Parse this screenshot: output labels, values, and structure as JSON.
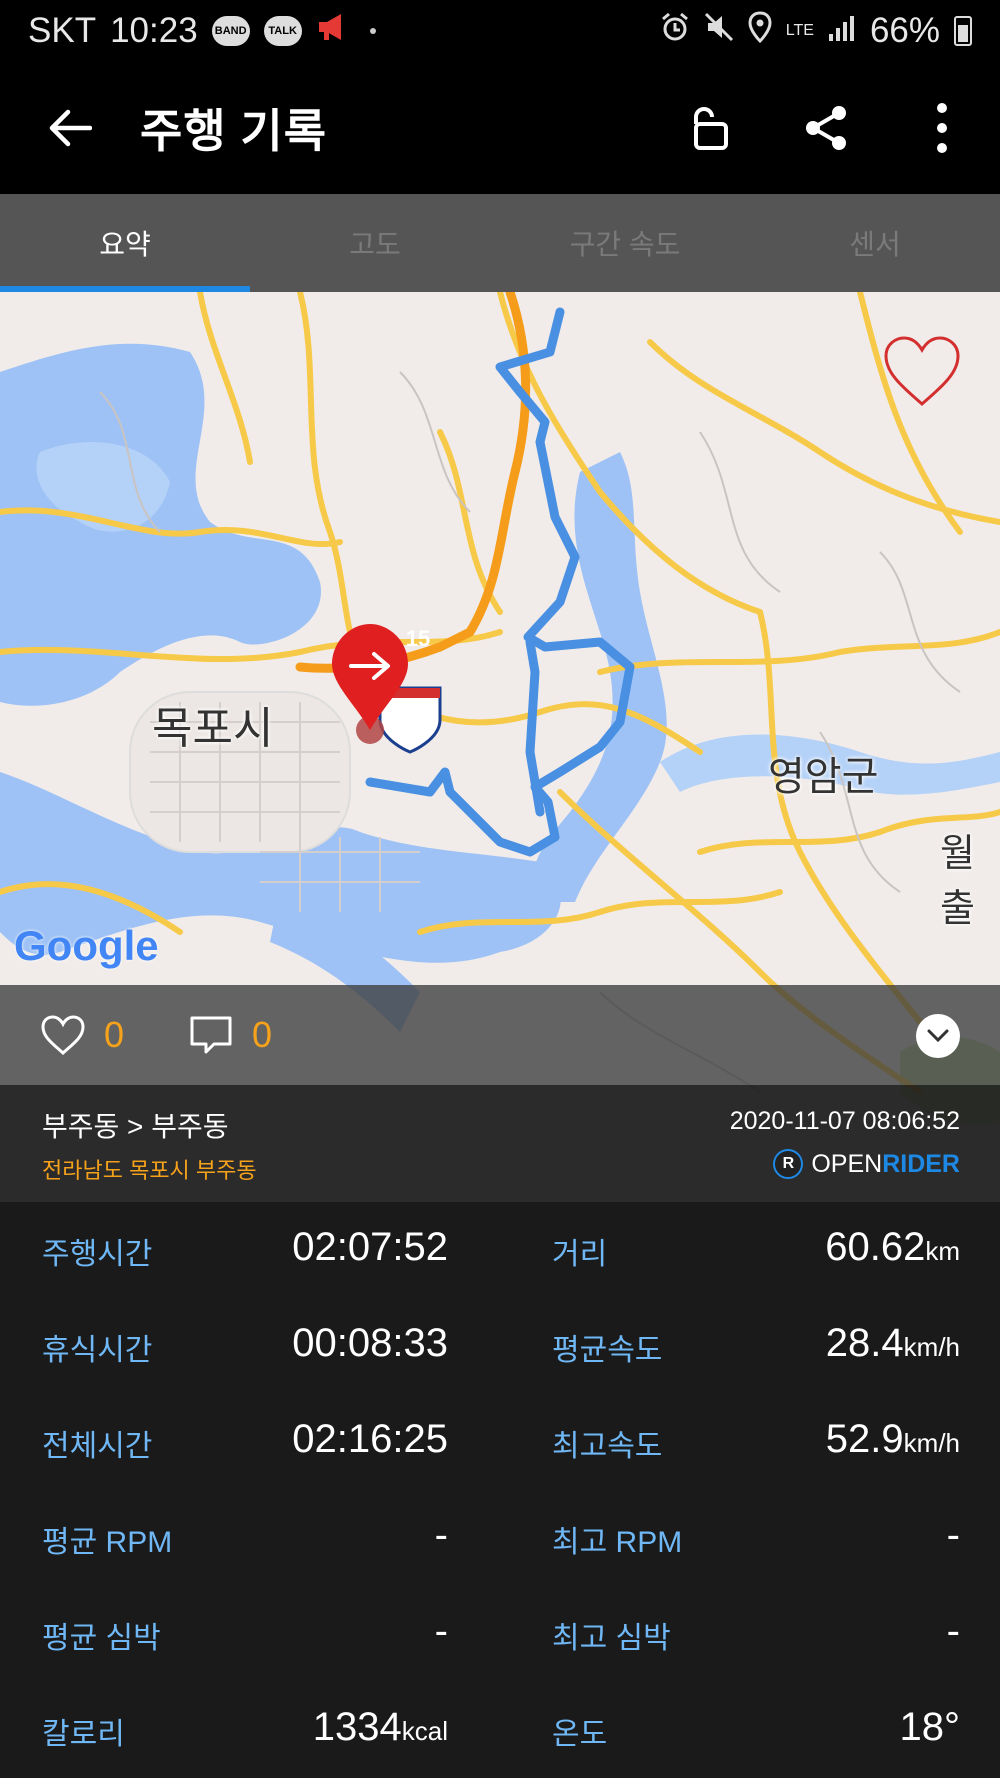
{
  "status_bar": {
    "carrier": "SKT",
    "time": "10:23",
    "badges": [
      "BAND",
      "TALK"
    ],
    "network": "LTE",
    "battery": "66%"
  },
  "app_bar": {
    "title": "주행 기록",
    "icons": [
      "back-arrow-icon",
      "unlock-icon",
      "share-icon",
      "more-vert-icon"
    ]
  },
  "tabs": [
    {
      "label": "요약",
      "active": true
    },
    {
      "label": "고도",
      "active": false
    },
    {
      "label": "구간 속도",
      "active": false
    },
    {
      "label": "센서",
      "active": false
    }
  ],
  "map": {
    "labels": {
      "mokpo": "목포시",
      "yeongam": "영암군",
      "wol": "월출",
      "highway": "15"
    },
    "google": "Google",
    "route_color": "#4a90e2",
    "marker_color": "#e02020"
  },
  "social": {
    "likes": "0",
    "comments": "0"
  },
  "route": {
    "title": "부주동 > 부주동",
    "address": "전라남도 목포시 부주동",
    "datetime": "2020-11-07 08:06:52",
    "brand_open": "OPEN",
    "brand_rider": "RIDER",
    "brand_logo_letter": "R"
  },
  "stats": {
    "ride_time": {
      "label": "주행시간",
      "value": "02:07:52"
    },
    "distance": {
      "label": "거리",
      "value": "60.62",
      "unit": "km"
    },
    "rest_time": {
      "label": "휴식시간",
      "value": "00:08:33"
    },
    "avg_speed": {
      "label": "평균속도",
      "value": "28.4",
      "unit": "km/h"
    },
    "total_time": {
      "label": "전체시간",
      "value": "02:16:25"
    },
    "max_speed": {
      "label": "최고속도",
      "value": "52.9",
      "unit": "km/h"
    },
    "avg_rpm": {
      "label": "평균 RPM",
      "value": "-"
    },
    "max_rpm": {
      "label": "최고 RPM",
      "value": "-"
    },
    "avg_hr": {
      "label": "평균 심박",
      "value": "-"
    },
    "max_hr": {
      "label": "최고 심박",
      "value": "-"
    },
    "calories": {
      "label": "칼로리",
      "value": "1334",
      "unit": "kcal"
    },
    "temperature": {
      "label": "온도",
      "value": "18°"
    }
  }
}
